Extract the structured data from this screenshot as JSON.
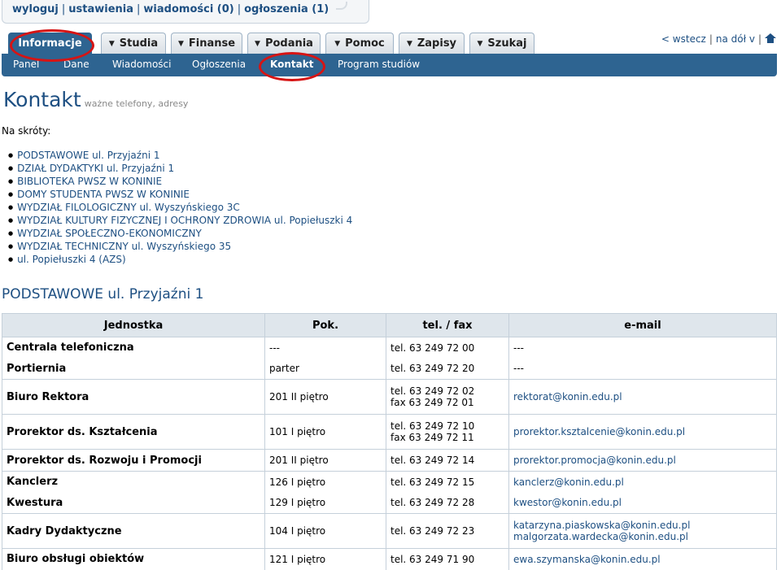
{
  "userbar": {
    "logout": "wyloguj",
    "settings": "ustawienia",
    "messages": "wiadomości (0)",
    "announcements": "ogłoszenia (1)"
  },
  "tabs": [
    {
      "label": "Informacje"
    },
    {
      "label": "Studia"
    },
    {
      "label": "Finanse"
    },
    {
      "label": "Podania"
    },
    {
      "label": "Pomoc"
    },
    {
      "label": "Zapisy"
    },
    {
      "label": "Szukaj"
    }
  ],
  "rightlinks": {
    "back": "< wstecz",
    "down": "na dół v"
  },
  "subnav": [
    "Panel",
    "Dane",
    "Wiadomości",
    "Ogłoszenia",
    "Kontakt",
    "Program studiów"
  ],
  "title": "Kontakt",
  "subtitle": "ważne telefony, adresy",
  "shortcuts_label": "Na skróty:",
  "shortcuts": [
    "PODSTAWOWE ul. Przyjaźni 1",
    "DZIAŁ DYDAKTYKI ul. Przyjaźni 1",
    "BIBLIOTEKA PWSZ W KONINIE",
    "DOMY STUDENTA PWSZ W KONINIE",
    "WYDZIAŁ FILOLOGICZNY ul. Wyszyńskiego 3C",
    "WYDZIAŁ KULTURY FIZYCZNEJ I OCHRONY ZDROWIA ul. Popiełuszki 4",
    "WYDZIAŁ SPOŁECZNO-EKONOMICZNY",
    "WYDZIAŁ TECHNICZNY ul. Wyszyńskiego 35",
    "ul. Popiełuszki 4 (AZS)"
  ],
  "section_title": "PODSTAWOWE ul. Przyjaźni 1",
  "table": {
    "headers": [
      "Jednostka",
      "Pok.",
      "tel. / fax",
      "e-mail"
    ],
    "rows": [
      {
        "name": "Centrala telefoniczna",
        "room": "---",
        "tel": [
          "tel. 63 249 72 00"
        ],
        "mail": [
          "---"
        ]
      },
      {
        "name": "Portiernia",
        "room": "parter",
        "tel": [
          "tel. 63 249 72 20"
        ],
        "mail": [
          "---"
        ]
      },
      {
        "name": "Biuro Rektora",
        "room": "201 II piętro",
        "tel": [
          "tel. 63 249 72 02",
          "fax 63 249 72 01"
        ],
        "mail": [
          "rektorat@konin.edu.pl"
        ]
      },
      {
        "name": "Prorektor ds. Kształcenia",
        "room": "101 I piętro",
        "tel": [
          "tel. 63 249 72 10",
          "fax 63 249 72 11"
        ],
        "mail": [
          "prorektor.ksztalcenie@konin.edu.pl"
        ]
      },
      {
        "name": "Prorektor ds. Rozwoju i Promocji",
        "room": "201 II piętro",
        "tel": [
          "tel. 63 249 72 14"
        ],
        "mail": [
          "prorektor.promocja@konin.edu.pl"
        ]
      },
      {
        "name": "Kanclerz",
        "room": "126 I piętro",
        "tel": [
          "tel. 63 249 72 15"
        ],
        "mail": [
          "kanclerz@konin.edu.pl"
        ]
      },
      {
        "name": "Kwestura",
        "room": "129 I piętro",
        "tel": [
          "tel. 63 249 72 28"
        ],
        "mail": [
          "kwestor@konin.edu.pl"
        ]
      },
      {
        "name": "Kadry Dydaktyczne",
        "room": "104 I piętro",
        "tel": [
          "tel. 63 249 72 23"
        ],
        "mail": [
          "katarzyna.piaskowska@konin.edu.pl",
          "malgorzata.wardecka@konin.edu.pl"
        ]
      },
      {
        "name": "Biuro obsługi obiektów",
        "room": "121 I piętro",
        "tel": [
          "tel. 63 249 71 90"
        ],
        "mail": [
          "ewa.szymanska@konin.edu.pl"
        ]
      }
    ]
  }
}
